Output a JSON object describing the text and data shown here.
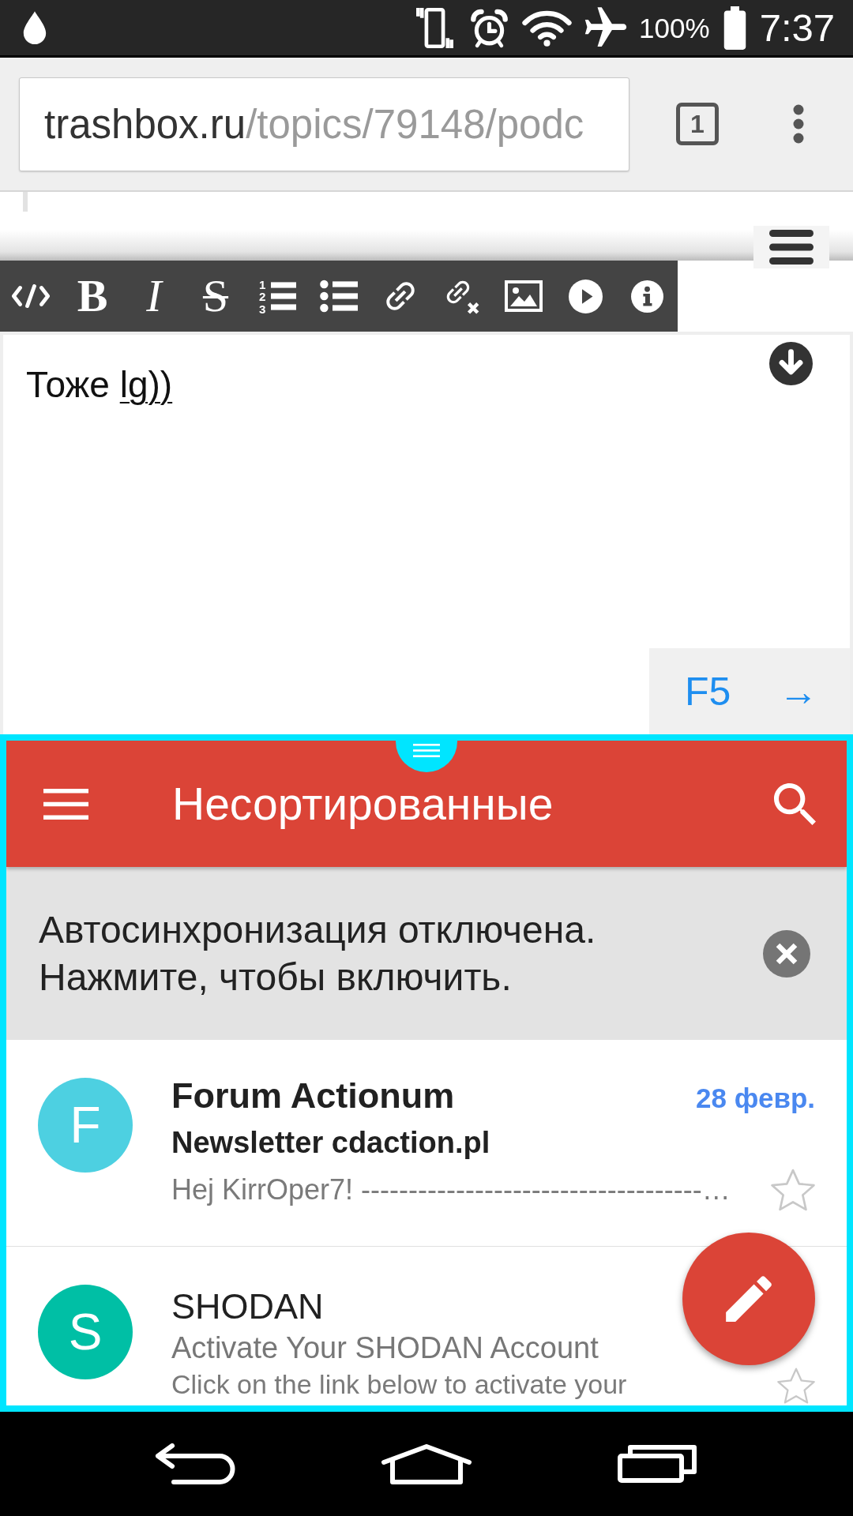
{
  "status_bar": {
    "battery_percent": "100%",
    "time": "7:37"
  },
  "browser": {
    "host": "trashbox.ru",
    "path": "/topics/79148/podc",
    "tab_count": "1"
  },
  "editor": {
    "toolbar": [
      {
        "kind": "code"
      },
      {
        "kind": "bold",
        "glyph": "B"
      },
      {
        "kind": "italic",
        "glyph": "I"
      },
      {
        "kind": "strikethrough",
        "glyph": "S"
      },
      {
        "kind": "ordered-list",
        "marks": [
          "1",
          "2",
          "3"
        ]
      },
      {
        "kind": "bullet-list"
      },
      {
        "kind": "link"
      },
      {
        "kind": "unlink"
      },
      {
        "kind": "image"
      },
      {
        "kind": "video"
      },
      {
        "kind": "info"
      }
    ],
    "text": "Тоже",
    "composing": "lg))",
    "actions": [
      {
        "kind": "refresh",
        "label": "F5"
      },
      {
        "kind": "send",
        "label": "→"
      }
    ]
  },
  "mail": {
    "title": "Несортированные",
    "banner": "Автосинхронизация отключена.\nНажмите, чтобы включить.",
    "messages": [
      {
        "initial": "F",
        "color": "#4dd0e1",
        "sender": "Forum Actionum",
        "date": "28 февр.",
        "subject": "Newsletter cdaction.pl",
        "snippet": "Hej KirrOper7! ------------------------------------…",
        "unread": true,
        "starred": false
      },
      {
        "initial": "S",
        "color": "#00bfa5",
        "sender": "SHODAN",
        "subject": "Activate Your SHODAN Account",
        "snippet": "Click on the link below to activate your",
        "unread": false,
        "starred": false
      }
    ]
  }
}
